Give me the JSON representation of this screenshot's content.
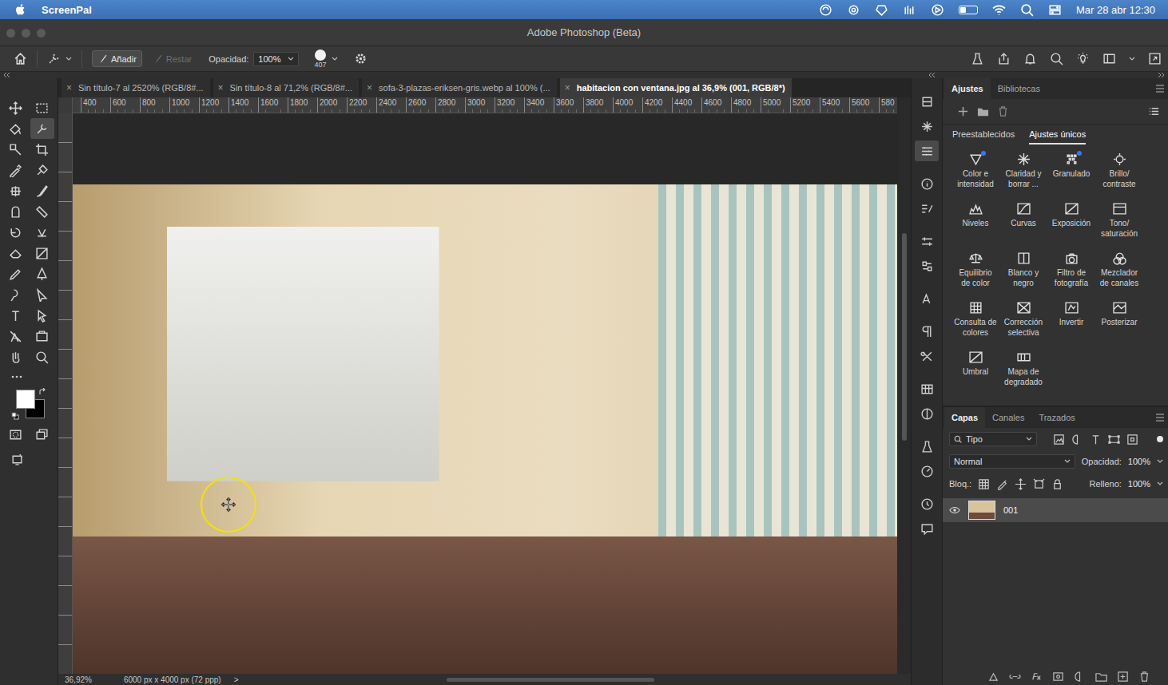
{
  "menubar": {
    "app": "ScreenPal",
    "clock": "Mar 28 abr 12:30",
    "battery_level": 0.35
  },
  "window": {
    "title": "Adobe Photoshop (Beta)"
  },
  "options_bar": {
    "modes": [
      {
        "label": "Añadir",
        "selected": true,
        "disabled": false
      },
      {
        "label": "Restar",
        "selected": false,
        "disabled": true
      }
    ],
    "opacity_label": "Opacidad:",
    "opacity_value": "100%",
    "brush_size": "407"
  },
  "tools": [
    {
      "selected": false
    },
    {
      "selected": false
    },
    {
      "selected": false
    },
    {
      "selected": true
    },
    {
      "selected": false
    },
    {
      "selected": false
    },
    {
      "selected": false
    },
    {
      "selected": false
    },
    {
      "selected": false
    },
    {
      "selected": false
    },
    {
      "selected": false
    },
    {
      "selected": false
    },
    {
      "selected": false
    },
    {
      "selected": false
    },
    {
      "selected": false
    },
    {
      "selected": false
    },
    {
      "selected": false
    },
    {
      "selected": false
    },
    {
      "selected": false
    },
    {
      "selected": false
    },
    {
      "selected": false
    },
    {
      "selected": false
    },
    {
      "selected": false
    },
    {
      "selected": false
    },
    {
      "selected": false
    },
    {
      "selected": false
    }
  ],
  "swatches": {
    "foreground": "#ffffff",
    "background": "#000000"
  },
  "document_tabs": [
    {
      "label": "Sin título-7 al 2520% (RGB/8#...",
      "close": "×",
      "selected": false
    },
    {
      "label": "Sin título-8 al 71,2% (RGB/8#...",
      "close": "×",
      "selected": false
    },
    {
      "label": "sofa-3-plazas-eriksen-gris.webp al 100% (...",
      "close": "×",
      "selected": false
    },
    {
      "label": "habitacion con ventana.jpg al 36,9% (001, RGB/8*)",
      "close": "×",
      "selected": true
    }
  ],
  "ruler": {
    "ticks": [
      "400",
      "600",
      "800",
      "1000",
      "1200",
      "1400",
      "1600",
      "1800",
      "2000",
      "2200",
      "2400",
      "2600",
      "2800",
      "3000",
      "3200",
      "3400",
      "3600",
      "3800",
      "4000",
      "4200",
      "4400",
      "4600",
      "4800",
      "5000",
      "5200",
      "5400",
      "5600",
      "580"
    ]
  },
  "status_bar": {
    "zoom": "36,92%",
    "size": "6000 px x 4000 px (72 ppp)",
    "arrow": ">"
  },
  "side_icons": [
    {
      "selected": false
    },
    {
      "selected": false
    },
    {
      "selected": true
    },
    {
      "selected": false
    },
    {
      "selected": false
    },
    {
      "selected": false
    },
    {
      "selected": false
    },
    {
      "selected": false
    },
    {
      "selected": false
    },
    {
      "selected": false
    },
    {
      "selected": false
    },
    {
      "selected": false
    },
    {
      "selected": false
    },
    {
      "selected": false
    },
    {
      "selected": false
    },
    {
      "selected": false
    }
  ],
  "adjustments_panel": {
    "tabs": [
      {
        "label": "Ajustes",
        "selected": true
      },
      {
        "label": "Bibliotecas",
        "selected": false
      }
    ],
    "subtabs": [
      {
        "label": "Preestablecidos",
        "selected": false
      },
      {
        "label": "Ajustes únicos",
        "selected": true
      }
    ],
    "items": [
      {
        "label": "Color e\nintensidad",
        "new": true
      },
      {
        "label": "Claridad y\nborrar ...",
        "new": false
      },
      {
        "label": "Granulado",
        "new": true
      },
      {
        "label": "Brillo/\ncontraste",
        "new": false
      },
      {
        "label": "Niveles",
        "new": false
      },
      {
        "label": "Curvas",
        "new": false
      },
      {
        "label": "Exposición",
        "new": false
      },
      {
        "label": "Tono/\nsaturación",
        "new": false
      },
      {
        "label": "Equilibrio\nde color",
        "new": false
      },
      {
        "label": "Blanco y\nnegro",
        "new": false
      },
      {
        "label": "Filtro de\nfotografía",
        "new": false
      },
      {
        "label": "Mezclador\nde canales",
        "new": false
      },
      {
        "label": "Consulta de\ncolores",
        "new": false
      },
      {
        "label": "Corrección\nselectiva",
        "new": false
      },
      {
        "label": "Invertir",
        "new": false
      },
      {
        "label": "Posterizar",
        "new": false
      },
      {
        "label": "Umbral",
        "new": false
      },
      {
        "label": "Mapa de\ndegradado",
        "new": false
      }
    ]
  },
  "layers_panel": {
    "tabs": [
      {
        "label": "Capas",
        "selected": true
      },
      {
        "label": "Canales",
        "selected": false
      },
      {
        "label": "Trazados",
        "selected": false
      }
    ],
    "filter": "Tipo",
    "blend_mode": "Normal",
    "opacity_label": "Opacidad:",
    "opacity_value": "100%",
    "lock_label": "Bloq.:",
    "fill_label": "Relleno:",
    "fill_value": "100%",
    "layers": [
      {
        "name": "001",
        "visible": true,
        "selected": true
      }
    ]
  }
}
